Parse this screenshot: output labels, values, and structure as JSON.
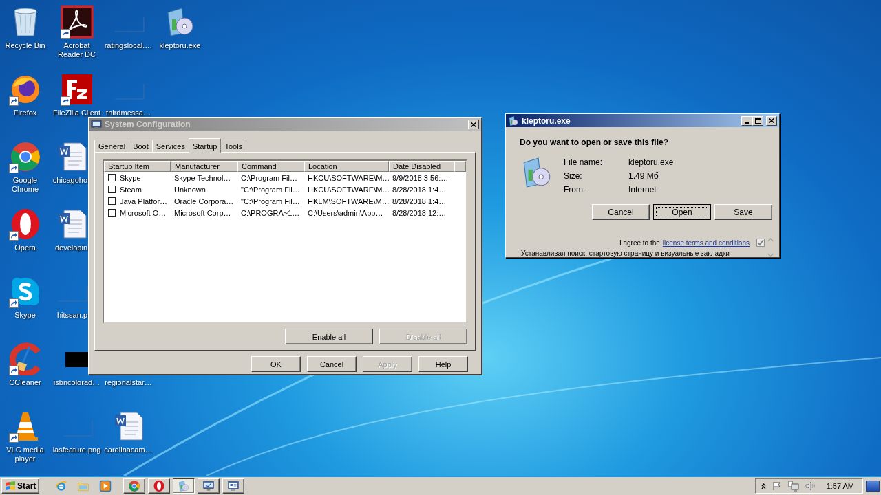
{
  "desktop": {
    "icons": [
      {
        "label": "Recycle Bin",
        "kind": "recycle-bin",
        "shortcut": false
      },
      {
        "label": "Acrobat Reader DC",
        "kind": "acrobat",
        "shortcut": true
      },
      {
        "label": "ratingslocal.…",
        "kind": "blank-image",
        "shortcut": false
      },
      {
        "label": "kleptoru.exe",
        "kind": "installer",
        "shortcut": false
      },
      {
        "label": "Firefox",
        "kind": "firefox",
        "shortcut": true
      },
      {
        "label": "FileZilla Client",
        "kind": "filezilla",
        "shortcut": true
      },
      {
        "label": "thirdmessa…",
        "kind": "blank-image",
        "shortcut": false
      },
      {
        "label": "Google Chrome",
        "kind": "chrome",
        "shortcut": true
      },
      {
        "label": "chicagoho",
        "kind": "word",
        "shortcut": false
      },
      {
        "label": "Opera",
        "kind": "opera",
        "shortcut": true
      },
      {
        "label": "developin",
        "kind": "word",
        "shortcut": false
      },
      {
        "label": "Skype",
        "kind": "skype",
        "shortcut": true
      },
      {
        "label": "hitssan.p",
        "kind": "blank-image",
        "shortcut": false
      },
      {
        "label": "CCleaner",
        "kind": "ccleaner",
        "shortcut": true
      },
      {
        "label": "isbncolorad…",
        "kind": "dark-image",
        "shortcut": false
      },
      {
        "label": "regionalstar…",
        "kind": "none"
      },
      {
        "label": "VLC media player",
        "kind": "vlc",
        "shortcut": true
      },
      {
        "label": "lasfeature.png",
        "kind": "blank-image",
        "shortcut": false
      },
      {
        "label": "carolinacam…",
        "kind": "word",
        "shortcut": false
      }
    ]
  },
  "system_configuration": {
    "title": "System Configuration",
    "tabs": [
      {
        "label": "General",
        "selected": false
      },
      {
        "label": "Boot",
        "selected": false
      },
      {
        "label": "Services",
        "selected": false
      },
      {
        "label": "Startup",
        "selected": true
      },
      {
        "label": "Tools",
        "selected": false
      }
    ],
    "table": {
      "columns": [
        "Startup Item",
        "Manufacturer",
        "Command",
        "Location",
        "Date Disabled"
      ],
      "rows": [
        {
          "checked": false,
          "cells": [
            "Skype",
            "Skype Technol…",
            "C:\\Program Fil…",
            "HKCU\\SOFTWARE\\M…",
            "9/9/2018 3:56:…"
          ]
        },
        {
          "checked": false,
          "cells": [
            "Steam",
            "Unknown",
            "\"C:\\Program Fil…",
            "HKCU\\SOFTWARE\\M…",
            "8/28/2018 1:4…"
          ]
        },
        {
          "checked": false,
          "cells": [
            "Java Platfor…",
            "Oracle Corpora…",
            "\"C:\\Program Fil…",
            "HKLM\\SOFTWARE\\M…",
            "8/28/2018 1:4…"
          ]
        },
        {
          "checked": false,
          "cells": [
            "Microsoft O…",
            "Microsoft Corp…",
            "C:\\PROGRA~1…",
            "C:\\Users\\admin\\App…",
            "8/28/2018 12:…"
          ]
        }
      ]
    },
    "list_buttons": [
      {
        "label": "Enable all",
        "disabled": false
      },
      {
        "label": "Disable all",
        "disabled": true
      }
    ],
    "buttons": [
      {
        "label": "OK",
        "disabled": false
      },
      {
        "label": "Cancel",
        "disabled": false
      },
      {
        "label": "Apply",
        "disabled": true
      },
      {
        "label": "Help",
        "disabled": false
      }
    ]
  },
  "download_dialog": {
    "title": "kleptoru.exe",
    "question": "Do you want to open or save this file?",
    "fields": [
      {
        "label": "File name:",
        "value": "kleptoru.exe"
      },
      {
        "label": "Size:",
        "value": "1.49 Мб"
      },
      {
        "label": "From:",
        "value": "Internet"
      }
    ],
    "buttons": [
      {
        "label": "Cancel",
        "default": false
      },
      {
        "label": "Open",
        "default": true
      },
      {
        "label": "Save",
        "default": false
      }
    ],
    "agree_text": "I agree to the",
    "agree_link": "license terms and conditions",
    "agree_checked": true,
    "notice": "Устанавливая поиск, стартовую страницу и визуальные закладки"
  },
  "taskbar": {
    "start": "Start",
    "quick_launch": [
      {
        "kind": "ie"
      },
      {
        "kind": "folder"
      },
      {
        "kind": "media"
      }
    ],
    "tasks": [
      {
        "kind": "chrome",
        "active": false
      },
      {
        "kind": "opera",
        "active": false
      },
      {
        "kind": "installer",
        "active": true
      },
      {
        "kind": "monitor",
        "active": false
      },
      {
        "kind": "monitor-window",
        "active": false
      }
    ],
    "clock": "1:57 AM"
  }
}
